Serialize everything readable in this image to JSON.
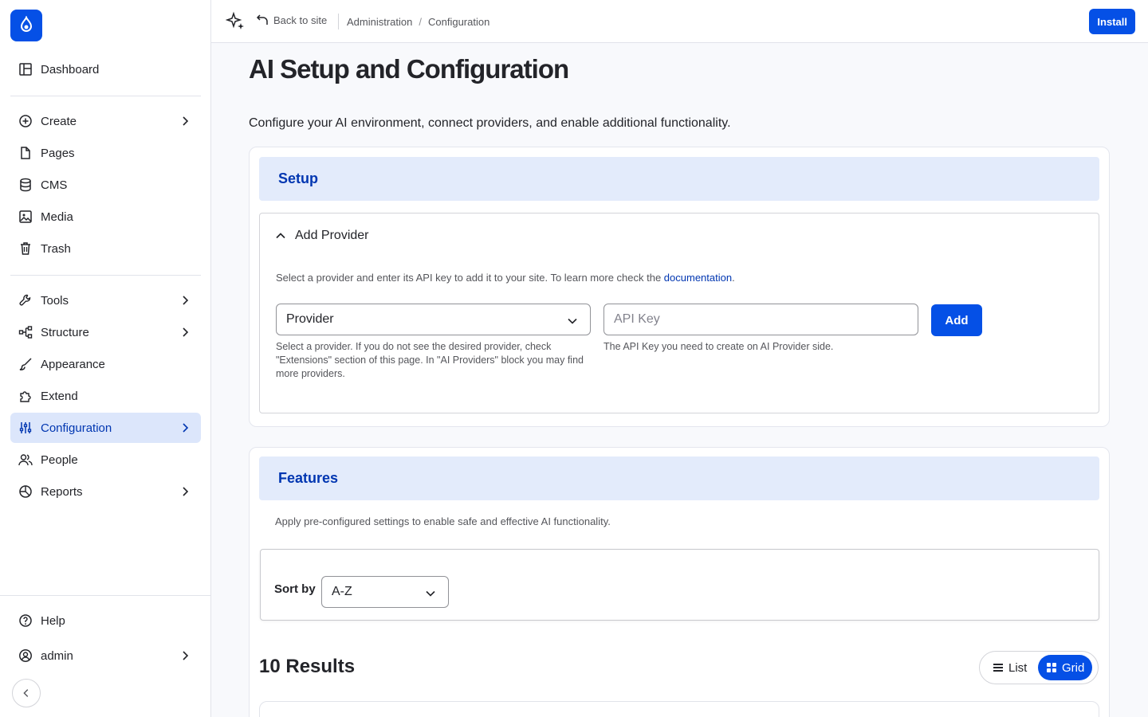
{
  "sidebar": {
    "items": [
      {
        "label": "Dashboard"
      },
      {
        "label": "Create"
      },
      {
        "label": "Pages"
      },
      {
        "label": "CMS"
      },
      {
        "label": "Media"
      },
      {
        "label": "Trash"
      },
      {
        "label": "Tools"
      },
      {
        "label": "Structure"
      },
      {
        "label": "Appearance"
      },
      {
        "label": "Extend"
      },
      {
        "label": "Configuration"
      },
      {
        "label": "People"
      },
      {
        "label": "Reports"
      }
    ],
    "help_label": "Help",
    "user_label": "admin"
  },
  "topbar": {
    "back_label": "Back to site",
    "breadcrumbs": [
      "Administration",
      "Configuration"
    ],
    "install_label": "Install"
  },
  "page": {
    "title": "AI Setup and Configuration",
    "description": "Configure your AI environment, connect providers, and enable additional functionality."
  },
  "setup": {
    "heading": "Setup",
    "details_title": "Add Provider",
    "description_prefix": "Select a provider and enter its API key to add it to your site. To learn more check the ",
    "description_link": "documentation",
    "description_suffix": ".",
    "provider_select": "Provider",
    "provider_help": "Select a provider. If you do not see the desired provider, check \"Extensions\" section of this page. In \"AI Providers\" block you may find more providers.",
    "api_key_placeholder": "API Key",
    "api_key_help": "The API Key you need to create on AI Provider side.",
    "add_label": "Add"
  },
  "features": {
    "heading": "Features",
    "description": "Apply pre-configured settings to enable safe and effective AI functionality.",
    "sort_label": "Sort by",
    "sort_value": "A-Z",
    "results": "10 Results",
    "view_list": "List",
    "view_grid": "Grid"
  },
  "colors": {
    "accent": "#0550e6",
    "heading_blue": "#0036b1",
    "active_bg": "#dce6fb"
  }
}
